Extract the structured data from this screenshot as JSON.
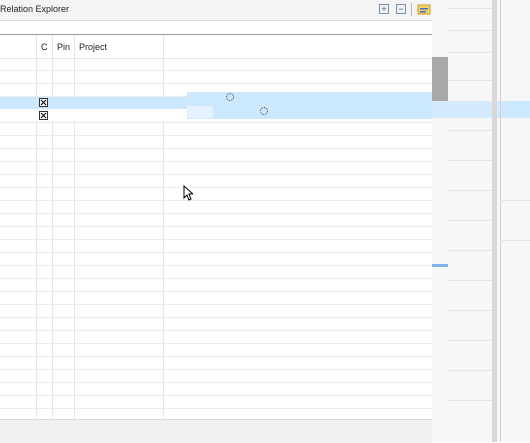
{
  "view": {
    "title": "Relation Explorer",
    "toolbar": {
      "expand_all_icon": "plus-box-icon",
      "collapse_all_icon": "minus-box-icon",
      "tree_icon": "folder-tree-icon"
    }
  },
  "table": {
    "columns": [
      "C",
      "Pin",
      "Project"
    ],
    "selected_row_icon": "x-box-icon",
    "accent_color": "#cce8ff"
  },
  "cursor_icon": "mouse-pointer-icon"
}
